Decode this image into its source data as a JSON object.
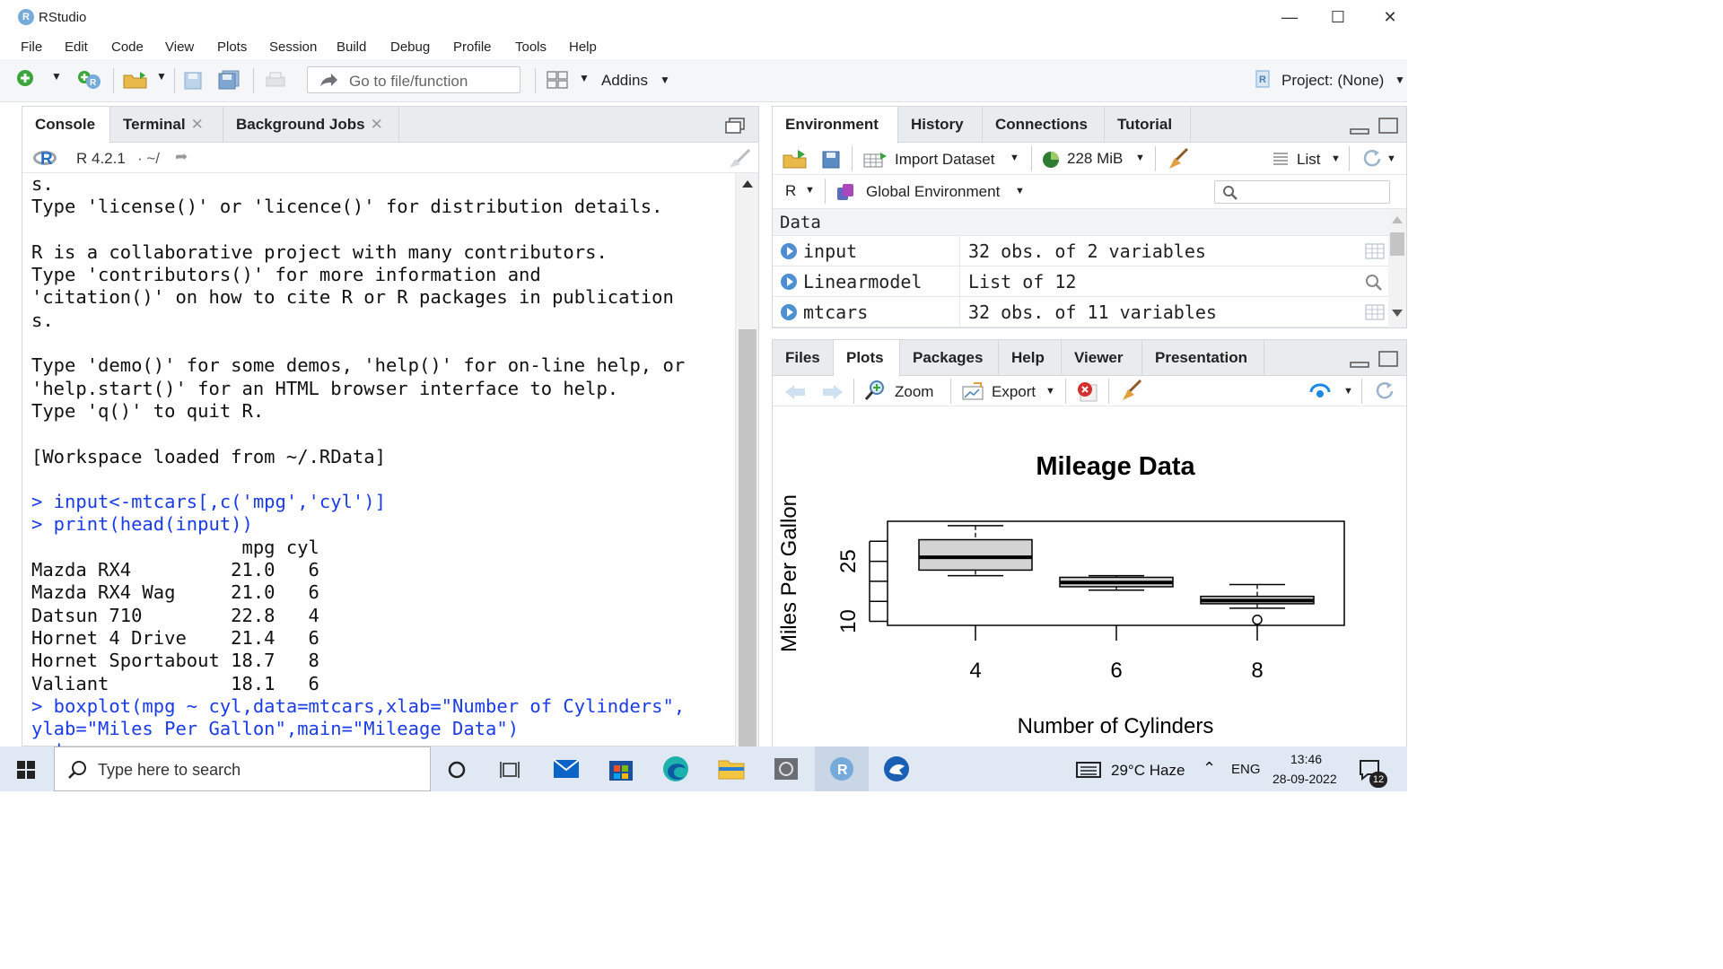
{
  "window": {
    "title": "RStudio"
  },
  "menu": [
    "File",
    "Edit",
    "Code",
    "View",
    "Plots",
    "Session",
    "Build",
    "Debug",
    "Profile",
    "Tools",
    "Help"
  ],
  "toolbar": {
    "goto_placeholder": "Go to file/function",
    "addins": "Addins",
    "project": "Project: (None)"
  },
  "console_pane": {
    "tabs": [
      "Console",
      "Terminal",
      "Background Jobs"
    ],
    "r_version": "R 4.2.1",
    "path": "· ~/",
    "lines": [
      {
        "t": "s.",
        "c": false
      },
      {
        "t": "Type 'license()' or 'licence()' for distribution details.",
        "c": false
      },
      {
        "t": "",
        "c": false
      },
      {
        "t": "R is a collaborative project with many contributors.",
        "c": false
      },
      {
        "t": "Type 'contributors()' for more information and",
        "c": false
      },
      {
        "t": "'citation()' on how to cite R or R packages in publication",
        "c": false
      },
      {
        "t": "s.",
        "c": false
      },
      {
        "t": "",
        "c": false
      },
      {
        "t": "Type 'demo()' for some demos, 'help()' for on-line help, or",
        "c": false
      },
      {
        "t": "'help.start()' for an HTML browser interface to help.",
        "c": false
      },
      {
        "t": "Type 'q()' to quit R.",
        "c": false
      },
      {
        "t": "",
        "c": false
      },
      {
        "t": "[Workspace loaded from ~/.RData]",
        "c": false
      },
      {
        "t": "",
        "c": false
      },
      {
        "t": "> input<-mtcars[,c('mpg','cyl')]",
        "c": true
      },
      {
        "t": "> print(head(input))",
        "c": true
      },
      {
        "t": "                   mpg cyl",
        "c": false
      },
      {
        "t": "Mazda RX4         21.0   6",
        "c": false
      },
      {
        "t": "Mazda RX4 Wag     21.0   6",
        "c": false
      },
      {
        "t": "Datsun 710        22.8   4",
        "c": false
      },
      {
        "t": "Hornet 4 Drive    21.4   6",
        "c": false
      },
      {
        "t": "Hornet Sportabout 18.7   8",
        "c": false
      },
      {
        "t": "Valiant           18.1   6",
        "c": false
      },
      {
        "t": "> boxplot(mpg ~ cyl,data=mtcars,xlab=\"Number of Cylinders\",",
        "c": true
      },
      {
        "t": "ylab=\"Miles Per Gallon\",main=\"Mileage Data\")",
        "c": true
      },
      {
        "t": "> |",
        "c": true
      }
    ]
  },
  "env_pane": {
    "tabs": [
      "Environment",
      "History",
      "Connections",
      "Tutorial"
    ],
    "import_dataset": "Import Dataset",
    "memory": "228 MiB",
    "list_view": "List",
    "language": "R",
    "scope": "Global Environment",
    "section": "Data",
    "rows": [
      {
        "name": "input",
        "value": "32 obs. of 2 variables"
      },
      {
        "name": "Linearmodel",
        "value": "List of  12"
      },
      {
        "name": "mtcars",
        "value": "32 obs. of 11 variables"
      }
    ]
  },
  "plots_pane": {
    "tabs": [
      "Files",
      "Plots",
      "Packages",
      "Help",
      "Viewer",
      "Presentation"
    ],
    "zoom": "Zoom",
    "export": "Export"
  },
  "chart_data": {
    "type": "boxplot",
    "title": "Mileage Data",
    "xlabel": "Number of Cylinders",
    "ylabel": "Miles Per Gallon",
    "categories": [
      "4",
      "6",
      "8"
    ],
    "yticks": [
      10,
      25
    ],
    "ylim": [
      9,
      35
    ],
    "boxes": [
      {
        "category": "4",
        "min": 21.4,
        "q1": 22.8,
        "median": 26.0,
        "q3": 30.4,
        "max": 33.9,
        "outliers": []
      },
      {
        "category": "6",
        "min": 17.8,
        "q1": 18.65,
        "median": 19.7,
        "q3": 21.0,
        "max": 21.4,
        "outliers": []
      },
      {
        "category": "8",
        "min": 13.3,
        "q1": 14.4,
        "median": 15.2,
        "q3": 16.25,
        "max": 19.2,
        "outliers": [
          10.4
        ]
      }
    ]
  },
  "taskbar": {
    "search_placeholder": "Type here to search",
    "weather": "29°C  Haze",
    "lang": "ENG",
    "time": "13:46",
    "date": "28-09-2022",
    "notifications": "12"
  }
}
